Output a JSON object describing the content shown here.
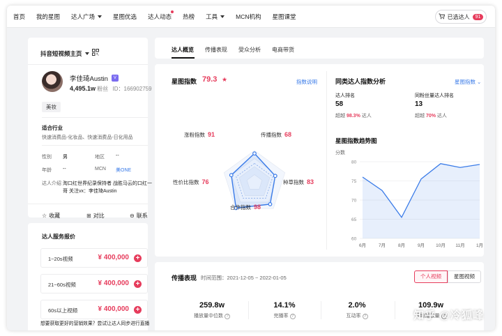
{
  "nav": {
    "items": [
      {
        "label": "首页",
        "caret": false,
        "dot": false
      },
      {
        "label": "我的星图",
        "caret": false,
        "dot": false
      },
      {
        "label": "达人广场",
        "caret": true,
        "dot": false
      },
      {
        "label": "星图优选",
        "caret": false,
        "dot": false
      },
      {
        "label": "达人动态",
        "caret": false,
        "dot": true
      },
      {
        "label": "热榜",
        "caret": false,
        "dot": false
      },
      {
        "label": "工具",
        "caret": true,
        "dot": false
      },
      {
        "label": "MCN机构",
        "caret": false,
        "dot": false
      },
      {
        "label": "星图课堂",
        "caret": false,
        "dot": false
      }
    ],
    "cart_label": "已选达人",
    "cart_count": "91"
  },
  "profile": {
    "platform": "抖音短视频主页",
    "name": "李佳琦Austin",
    "fans": "4,495.1w",
    "fans_label": "粉丝",
    "id_text": "ID：166902759",
    "tag": "美妆",
    "industry_title": "适合行业",
    "industry": "快速消费品-化妆品、快速消费品-日化用品",
    "gender_label": "性别",
    "gender": "男",
    "region_label": "地区",
    "region": "--",
    "age_label": "年龄",
    "age": "--",
    "mcn_label": "MCN",
    "mcn": "美ONE",
    "intro_label": "达人介绍",
    "intro_line1": "淘口红世界纪录保持者 战胜马云的口红一",
    "intro_line2": "哥 关注vx：李佳琦Austin",
    "actions": [
      "收藏",
      "对比",
      "联系"
    ]
  },
  "pricing": {
    "title": "达人服务报价",
    "rows": [
      {
        "label": "1~20s视频",
        "price": "¥ 400,000"
      },
      {
        "label": "21~60s视频",
        "price": "¥ 400,000"
      },
      {
        "label": "60s以上视频",
        "price": "¥ 400,000"
      }
    ],
    "footer": "想要获取更好的营销效果？尝试让达人同步进行直播"
  },
  "tabs": [
    "达人概览",
    "传播表现",
    "受众分析",
    "电商带货"
  ],
  "index": {
    "title": "星图指数",
    "score": "79.3",
    "link": "指数说明",
    "radar": [
      {
        "label": "涨粉指数",
        "value": "91"
      },
      {
        "label": "传播指数",
        "value": "68"
      },
      {
        "label": "种草指数",
        "value": "83"
      },
      {
        "label": "合作指数",
        "value": "98"
      },
      {
        "label": "性价比指数",
        "value": "76"
      }
    ]
  },
  "peer": {
    "title": "同类达人指数分析",
    "dropdown": "星图指数",
    "rank_label": "达人排名",
    "rank": "58",
    "rank_beat_prefix": "超越",
    "rank_beat": "98.3%",
    "rank_beat_suffix": "达人",
    "fans_rank_label": "同粉丝量达人排名",
    "fans_rank": "13",
    "fans_beat_prefix": "超越",
    "fans_beat": "70%",
    "fans_beat_suffix": "达人"
  },
  "trend": {
    "title": "星图指数趋势图",
    "ylabel": "分数"
  },
  "chart_data": {
    "type": "area",
    "title": "星图指数趋势图",
    "ylabel": "分数",
    "xlabel": "",
    "categories": [
      "6月",
      "7月",
      "8月",
      "9月",
      "10月",
      "11月",
      "1月"
    ],
    "values": [
      76,
      72.5,
      65.5,
      75.5,
      79.5,
      78.5,
      79.3
    ],
    "ylim": [
      60,
      80
    ],
    "yticks": [
      "60",
      "65",
      "70",
      "75",
      "80"
    ],
    "color": "#3a7be8",
    "grid": true
  },
  "perf": {
    "title": "传播表现",
    "range": "时间范围：2021-12-05 ~ 2022-01-05",
    "toggle_on": "个人视频",
    "toggle_off": "星图视频",
    "metrics": [
      {
        "value": "259.8w",
        "label": "播放量中位数"
      },
      {
        "value": "14.1%",
        "label": "完播率"
      },
      {
        "value": "2.0%",
        "label": "互动率"
      },
      {
        "value": "109.9w",
        "label": "平均播放量"
      }
    ]
  },
  "watermark": "知乎 @冷狐峰",
  "accent": "#e63c5c",
  "link_color": "#3a7be8"
}
